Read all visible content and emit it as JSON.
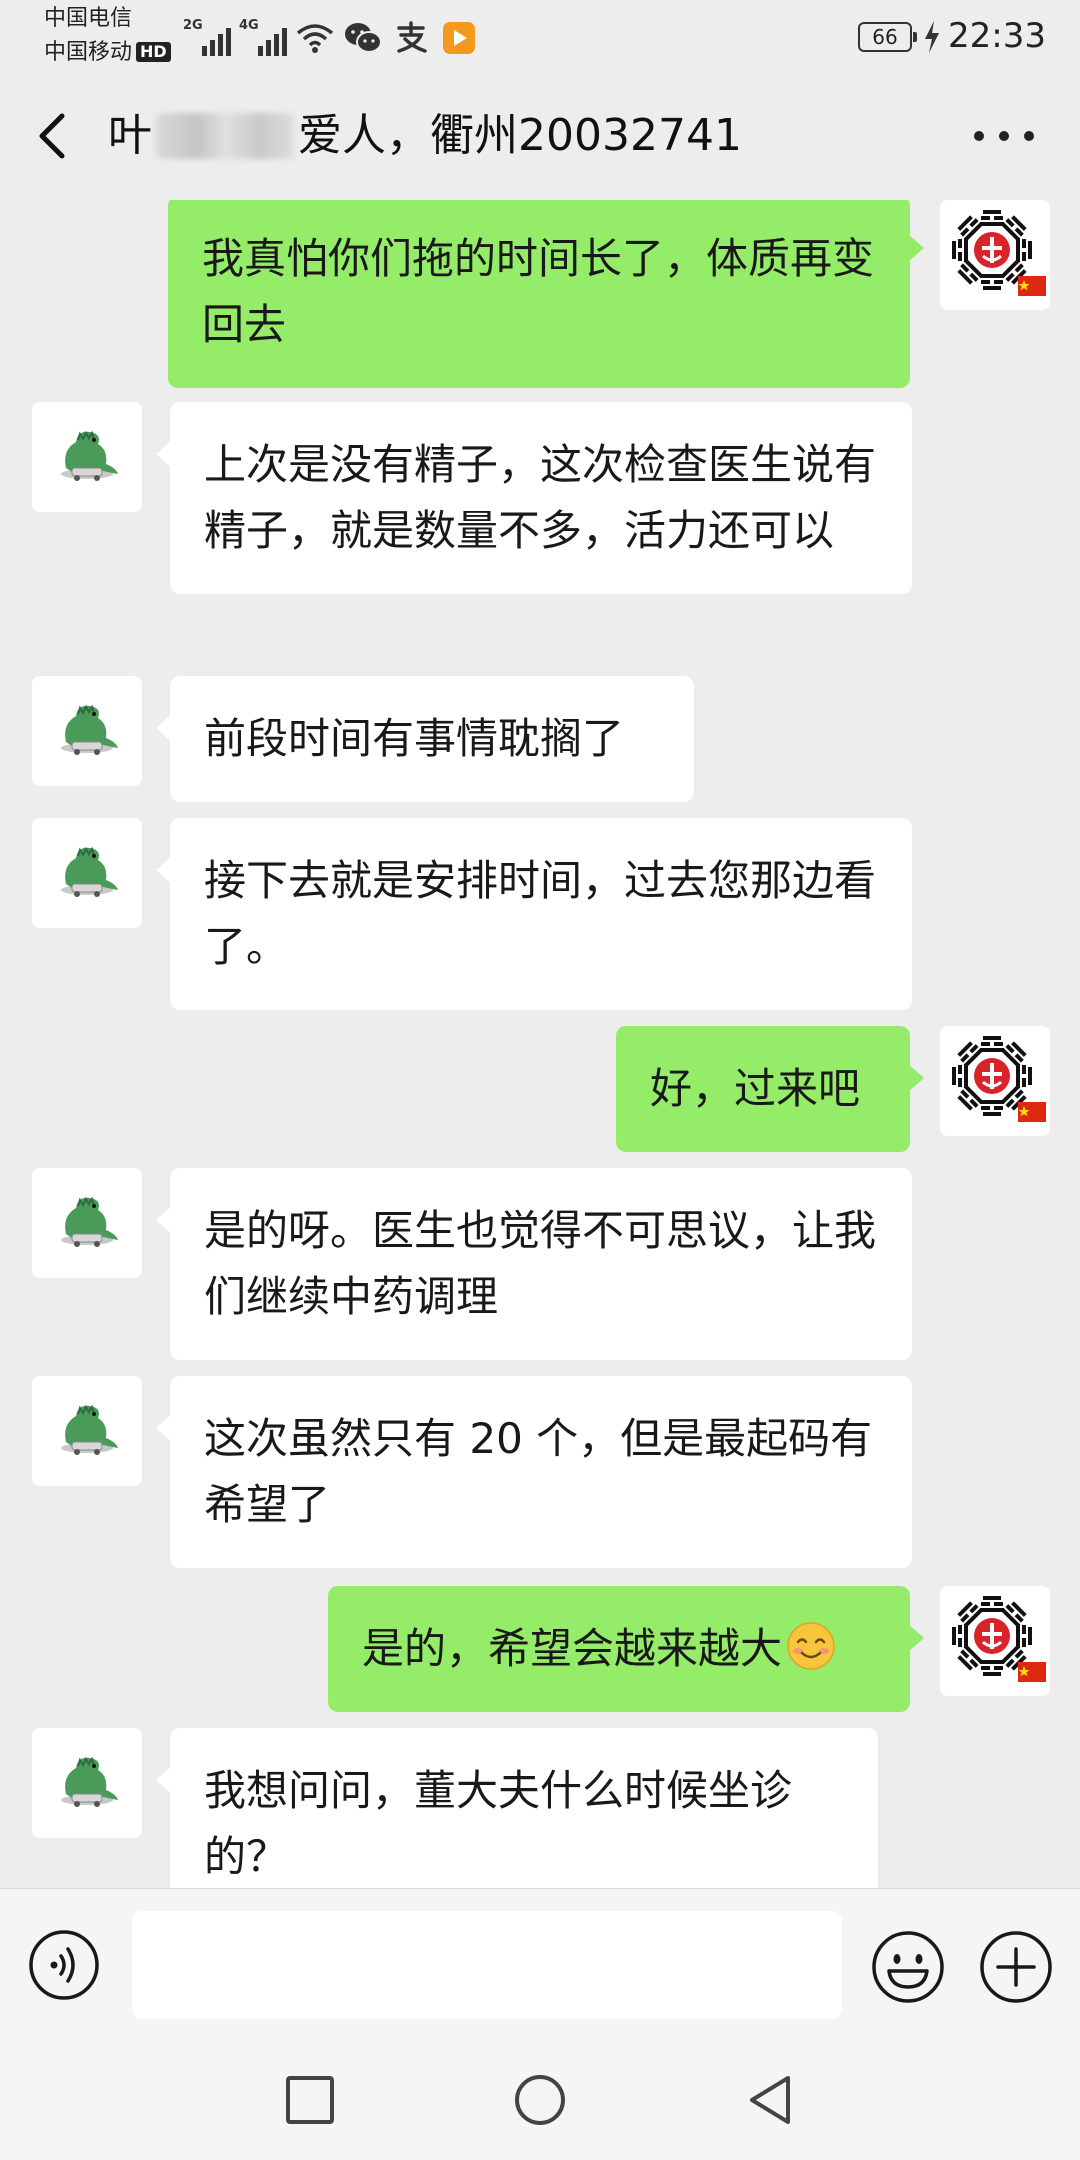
{
  "status_bar": {
    "carrier1": "中国电信",
    "carrier2": "中国移动",
    "hd_label": "HD",
    "sim1_network": "2G",
    "sim2_network": "4G",
    "battery": "66",
    "time": "22:33",
    "icons": [
      "signal-icon",
      "signal-icon",
      "wifi-icon",
      "wechat-icon",
      "alipay-icon",
      "video-app-icon",
      "charging-icon"
    ]
  },
  "header": {
    "title_prefix": "叶",
    "title_suffix": "爱人，衢州20032741",
    "back_icon": "chevron-left-icon",
    "more_icon": "more-dots-icon"
  },
  "messages": [
    {
      "side": "out",
      "text": "我真怕你们拖的时间长了，体质再变回去"
    },
    {
      "side": "in",
      "text": "上次是没有精子，这次检查医生说有精子，就是数量不多，活力还可以"
    },
    {
      "side": "in",
      "text": "前段时间有事情耽搁了"
    },
    {
      "side": "in",
      "text": "接下去就是安排时间，过去您那边看了。"
    },
    {
      "side": "out",
      "text": "好，过来吧"
    },
    {
      "side": "in",
      "text": "是的呀。医生也觉得不可思议，让我们继续中药调理"
    },
    {
      "side": "in",
      "text": "这次虽然只有 20 个，但是最起码有希望了"
    },
    {
      "side": "out",
      "text": "是的，希望会越来越大"
    },
    {
      "side": "in",
      "text": "我想问问，董大夫什么时候坐诊的？"
    }
  ],
  "input_bar": {
    "placeholder": "",
    "value": ""
  },
  "colors": {
    "background": "#ededed",
    "outgoing_bubble": "#95ec69",
    "incoming_bubble": "#ffffff",
    "text": "#191919"
  }
}
